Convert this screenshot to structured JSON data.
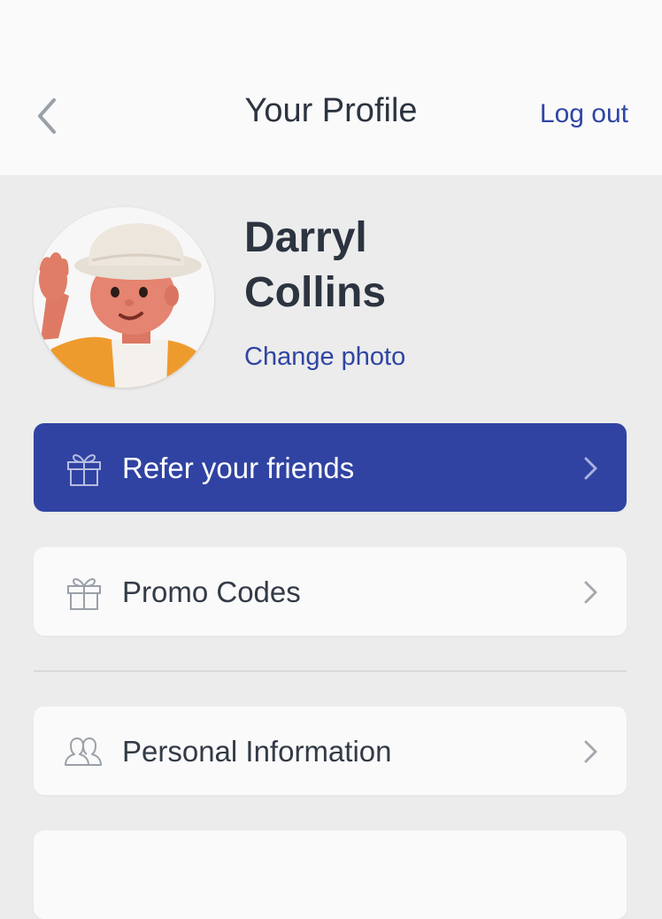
{
  "header": {
    "title": "Your Profile",
    "logout_label": "Log out",
    "back_icon": "chevron-left-icon"
  },
  "profile": {
    "name": "Darryl Collins",
    "change_photo_label": "Change photo"
  },
  "menu": {
    "items": [
      {
        "label": "Refer your friends",
        "icon": "gift-icon",
        "style": "primary"
      },
      {
        "label": "Promo Codes",
        "icon": "gift-icon",
        "style": "default"
      },
      {
        "label": "Personal Information",
        "icon": "users-icon",
        "style": "default"
      }
    ]
  },
  "colors": {
    "accent": "#3043a2",
    "link": "#2f45a3",
    "text": "#2c3440",
    "background": "#ececec",
    "card": "#fafafa"
  }
}
